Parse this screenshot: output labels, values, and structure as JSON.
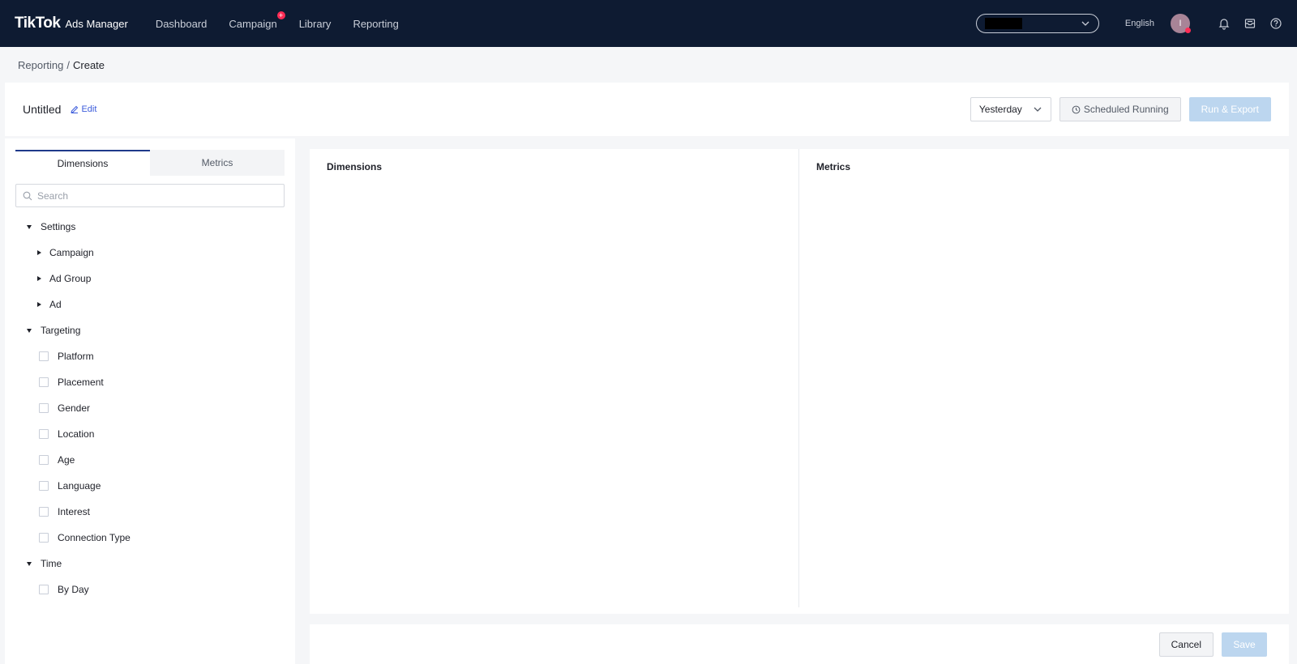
{
  "header": {
    "brand": "TikTok",
    "product": "Ads Manager",
    "nav": [
      {
        "label": "Dashboard"
      },
      {
        "label": "Campaign",
        "badge": "+"
      },
      {
        "label": "Library"
      },
      {
        "label": "Reporting"
      }
    ],
    "language": "English",
    "avatar_initial": "I",
    "icons": [
      "bell-icon",
      "inbox-icon",
      "help-icon"
    ]
  },
  "breadcrumb": {
    "parent": "Reporting",
    "separator": "/",
    "current": "Create"
  },
  "report": {
    "title": "Untitled",
    "edit_label": "Edit",
    "date_range": "Yesterday",
    "scheduled_label": "Scheduled Running",
    "run_export_label": "Run & Export"
  },
  "left_panel": {
    "tabs": [
      {
        "label": "Dimensions",
        "active": true
      },
      {
        "label": "Metrics",
        "active": false
      }
    ],
    "search_placeholder": "Search",
    "tree": {
      "settings": {
        "label": "Settings",
        "children": [
          "Campaign",
          "Ad Group",
          "Ad"
        ]
      },
      "targeting": {
        "label": "Targeting",
        "children": [
          "Platform",
          "Placement",
          "Gender",
          "Location",
          "Age",
          "Language",
          "Interest",
          "Connection Type"
        ]
      },
      "time": {
        "label": "Time",
        "children": [
          "By Day"
        ]
      }
    }
  },
  "main": {
    "dimensions_header": "Dimensions",
    "metrics_header": "Metrics"
  },
  "footer": {
    "cancel_label": "Cancel",
    "save_label": "Save"
  },
  "colors": {
    "topbar": "#0e1b32",
    "accent_tab": "#1e3a8a",
    "disabled_primary": "#bcd6ef",
    "badge": "#fe2c55"
  }
}
